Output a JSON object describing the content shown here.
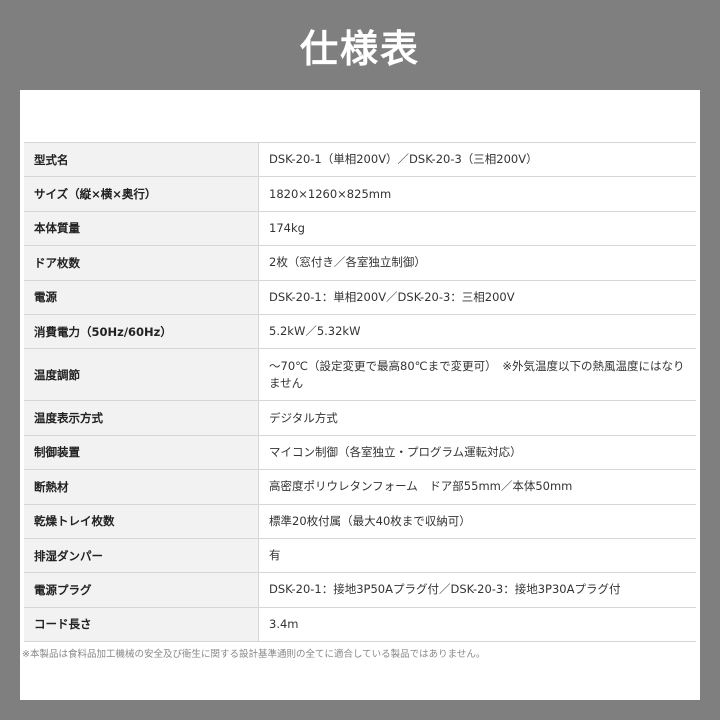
{
  "header": {
    "title": "仕様表"
  },
  "specs": [
    {
      "label": "型式名",
      "value": "DSK-20-1（単相200V）／DSK-20-3（三相200V）"
    },
    {
      "label": "サイズ（縦×横×奥行）",
      "value": "1820×1260×825mm"
    },
    {
      "label": "本体質量",
      "value": "174kg"
    },
    {
      "label": "ドア枚数",
      "value": "2枚（窓付き／各室独立制御）"
    },
    {
      "label": "電源",
      "value": "DSK-20-1：単相200V／DSK-20-3：三相200V"
    },
    {
      "label": "消費電力（50Hz/60Hz）",
      "value": "5.2kW／5.32kW"
    },
    {
      "label": "温度調節",
      "value": "～70℃（設定変更で最高80℃まで変更可）　※外気温度以下の熱風温度にはなりません"
    },
    {
      "label": "温度表示方式",
      "value": "デジタル方式"
    },
    {
      "label": "制御装置",
      "value": "マイコン制御（各室独立・プログラム運転対応）"
    },
    {
      "label": "断熱材",
      "value": "高密度ポリウレタンフォーム　ドア部55mm／本体50mm"
    },
    {
      "label": "乾燥トレイ枚数",
      "value": "標準20枚付属（最大40枚まで収納可）"
    },
    {
      "label": "排湿ダンパー",
      "value": "有"
    },
    {
      "label": "電源プラグ",
      "value": "DSK-20-1：接地3P50Aプラグ付／DSK-20-3：接地3P30Aプラグ付"
    },
    {
      "label": "コード長さ",
      "value": "3.4m"
    }
  ],
  "footnote": "※本製品は食料品加工機械の安全及び衛生に関する設計基準通則の全てに適合している製品ではありません。"
}
